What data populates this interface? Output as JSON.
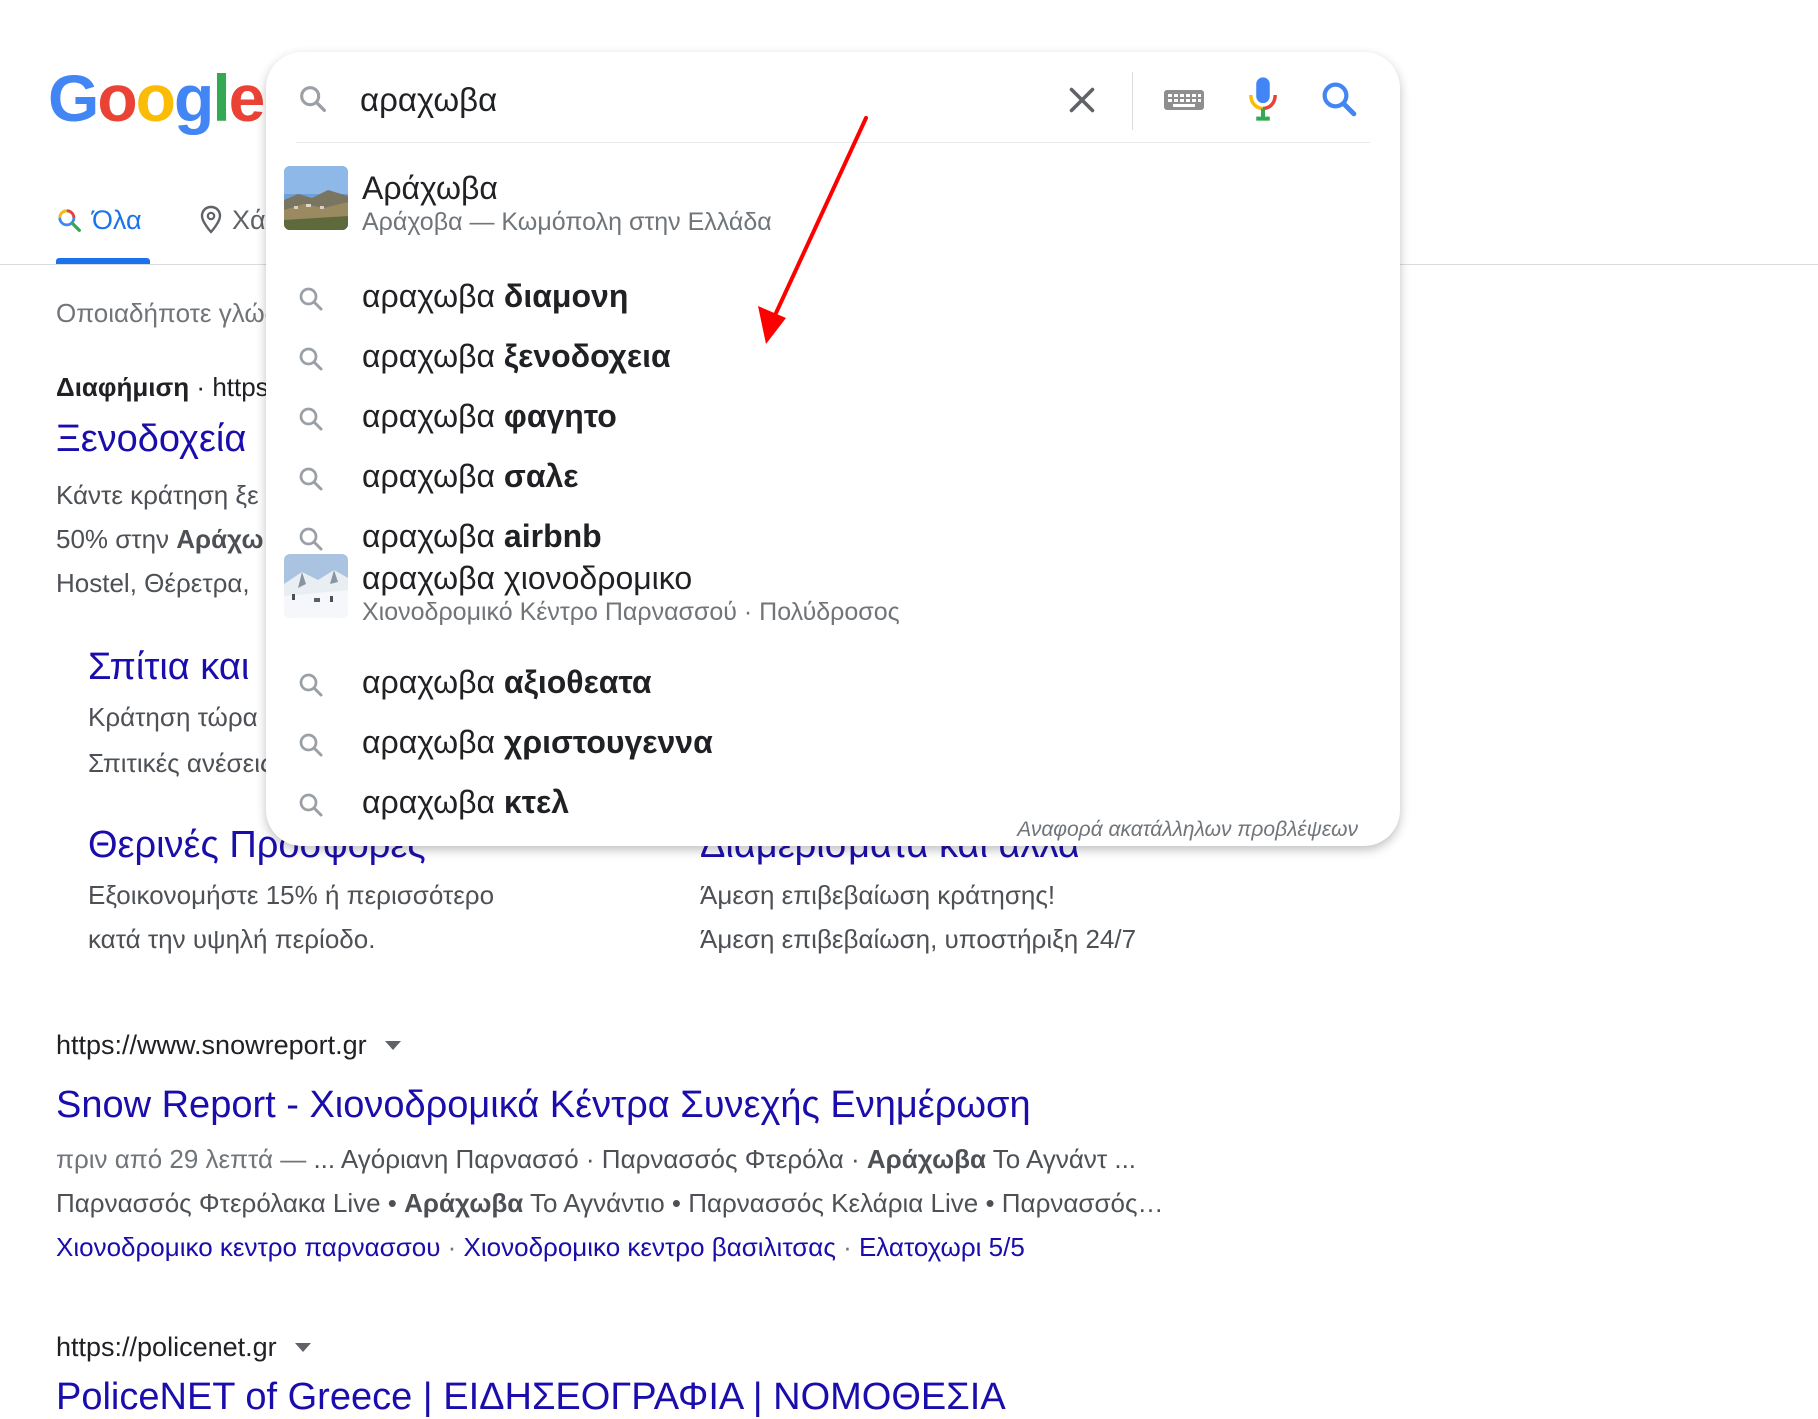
{
  "logo": {
    "letters": [
      "G",
      "o",
      "o",
      "g",
      "l",
      "e"
    ],
    "colors": [
      "#4285F4",
      "#EA4335",
      "#FBBC05",
      "#4285F4",
      "#34A853",
      "#EA4335"
    ]
  },
  "tabs": {
    "all": "Όλα",
    "maps": "Χάρτες"
  },
  "any_language": "Οποιαδήποτε γλώσσα",
  "ad": {
    "label": "Διαφήμιση",
    "url": "https://",
    "title": "Ξενοδοχεία",
    "line1": "Κάντε κράτηση ξε",
    "line2_pre": "50% στην ",
    "line2_bold": "Αράχω",
    "line3": "Hostel, Θέρετρα,",
    "sitelinks": [
      {
        "title": "Σπίτια και",
        "desc1": "Κράτηση τώρα",
        "desc2": "Σπιτικές ανέσεις"
      },
      {
        "title": "Θερινές Προσφορές",
        "desc1": "Εξοικονομήστε 15% ή περισσότερο",
        "desc2": "κατά την υψηλή περίοδο."
      },
      {
        "title": "Διαμερίσματα και άλλα",
        "desc1": "Άμεση επιβεβαίωση κράτησης!",
        "desc2": "Άμεση επιβεβαίωση, υποστήριξη 24/7"
      }
    ]
  },
  "results": [
    {
      "url": "https://www.snowreport.gr",
      "title": "Snow Report - Χιονοδρομικά Κέντρα Συνεχής Ενημέρωση",
      "snip1_gray": "πριν από 29 λεπτά — ",
      "snip1_a": "... Αγόριανη Παρνασσό · Παρνασσός Φτερόλα · ",
      "snip1_b": "Αράχωβα",
      "snip1_c": " Το Αγνάντ ...",
      "snip2_a": "Παρνασσός Φτερόλακα Live • ",
      "snip2_b": "Αράχωβα",
      "snip2_c": " Το Αγνάντιο • Παρνασσός Κελάρια Live • Παρνασσός…",
      "links": [
        "Χιονοδρομικο κεντρο παρνασσου",
        "Χιονοδρομικο κεντρο βασιλιτσας",
        "Ελατοχωρι 5/5"
      ]
    },
    {
      "url": "https://policenet.gr",
      "title": "PoliceNET of Greece | ΕΙΔΗΣΕΟΓΡΑΦΙΑ | ΝΟΜΟΘΕΣΙΑ"
    }
  ],
  "search": {
    "query": "αραχωβα",
    "suggestions": [
      {
        "kind": "entity",
        "text": "Αράχωβα",
        "sub": "Αράχοβα — Κωμόπολη στην Ελλάδα"
      },
      {
        "kind": "query",
        "base": "αραχωβα ",
        "bold": "διαμονη"
      },
      {
        "kind": "query",
        "base": "αραχωβα ",
        "bold": "ξενοδοχεια"
      },
      {
        "kind": "query",
        "base": "αραχωβα ",
        "bold": "φαγητο"
      },
      {
        "kind": "query",
        "base": "αραχωβα ",
        "bold": "σαλε"
      },
      {
        "kind": "query",
        "base": "αραχωβα ",
        "bold": "airbnb"
      },
      {
        "kind": "entity",
        "text": "αραχωβα χιονοδρομικο",
        "sub": "Χιονοδρομικό Κέντρο Παρνασσού · Πολύδροσος"
      },
      {
        "kind": "query",
        "base": "αραχωβα ",
        "bold": "αξιοθεατα"
      },
      {
        "kind": "query",
        "base": "αραχωβα ",
        "bold": "χριστουγεννα"
      },
      {
        "kind": "query",
        "base": "αραχωβα ",
        "bold": "κτελ"
      }
    ],
    "report": "Αναφορά ακατάλληλων προβλέψεων"
  },
  "colors": {
    "link": "#1a0dab",
    "accent": "#1a73e8",
    "annotation_arrow": "#ff0000"
  }
}
